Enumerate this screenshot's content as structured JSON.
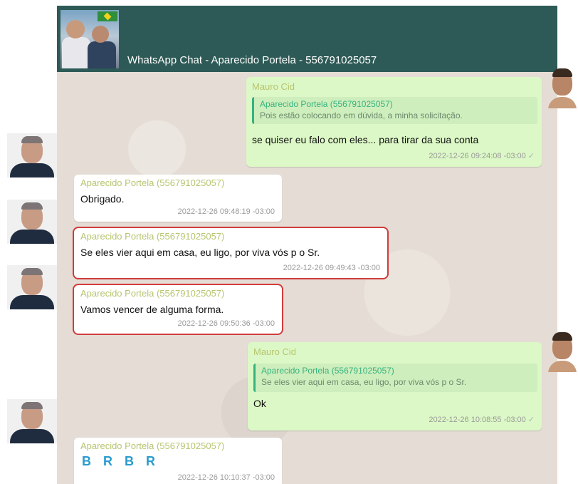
{
  "header": {
    "title": "WhatsApp Chat - Aparecido Portela - 556791025057"
  },
  "messages": [
    {
      "sender": "Mauro Cid",
      "quote_sender": "Aparecido Portela (556791025057)",
      "quote_text": "Pois estão colocando em dúvida, a minha solicitação.",
      "text": "se quiser eu falo com eles... para tirar da sua conta",
      "timestamp": "2022-12-26 09:24:08 -03:00",
      "tick": "✓"
    },
    {
      "sender": "Aparecido Portela (556791025057)",
      "text": "Obrigado.",
      "timestamp": "2022-12-26 09:48:19 -03:00"
    },
    {
      "sender": "Aparecido Portela (556791025057)",
      "text": "Se eles vier aqui em casa, eu ligo, por viva vós p o Sr.",
      "timestamp": "2022-12-26 09:49:43 -03:00"
    },
    {
      "sender": "Aparecido Portela (556791025057)",
      "text": "Vamos vencer de alguma forma.",
      "timestamp": "2022-12-26 09:50:36 -03:00"
    },
    {
      "sender": "Mauro Cid",
      "quote_sender": "Aparecido Portela (556791025057)",
      "quote_text": "Se eles vier aqui em casa, eu ligo, por viva vós p o Sr.",
      "text": "Ok",
      "timestamp": "2022-12-26 10:08:55 -03:00",
      "tick": "✓"
    },
    {
      "sender": "Aparecido Portela (556791025057)",
      "text": "B R B R",
      "timestamp": "2022-12-26 10:10:37 -03:00"
    }
  ],
  "colors": {
    "header_bg": "#2d5a56",
    "outgoing_bubble": "#dcf8c6",
    "incoming_bubble": "#ffffff",
    "sender_name": "#b7c56f",
    "quote_accent": "#35b37e",
    "highlight_border": "#d13c3c",
    "brbr_text": "#2a9bd0"
  }
}
